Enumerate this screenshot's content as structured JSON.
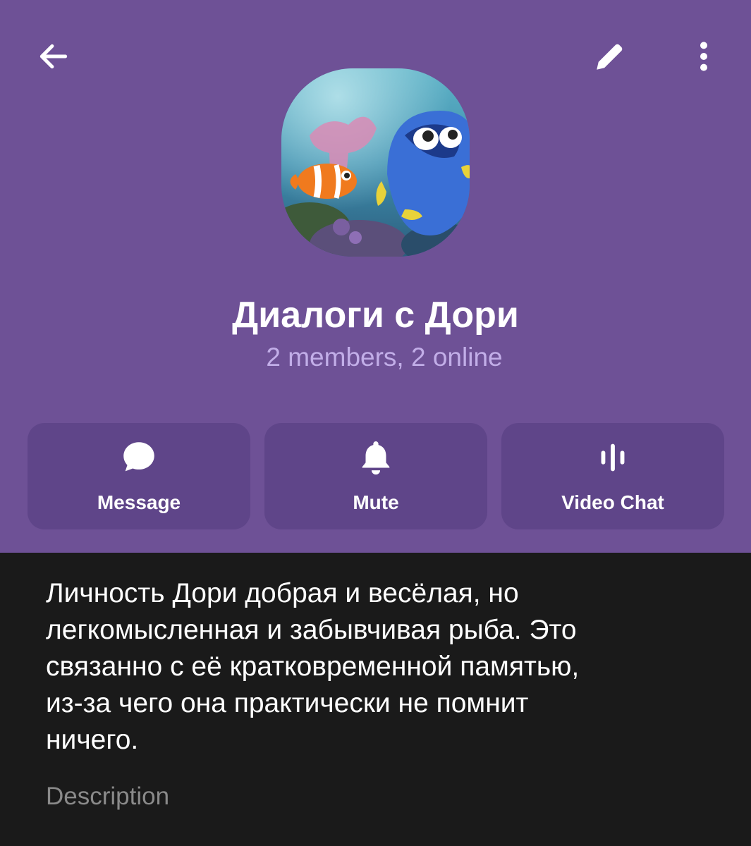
{
  "header": {
    "title": "Диалоги с Дори",
    "subtitle": "2 members, 2 online",
    "background_color": "#6e5196",
    "icons": {
      "back": "arrow-left-icon",
      "edit": "pencil-icon",
      "more": "more-vertical-icon"
    }
  },
  "avatar": {
    "description_visible": false
  },
  "actions": [
    {
      "label": "Message",
      "icon": "chat-bubble-icon"
    },
    {
      "label": "Mute",
      "icon": "bell-icon"
    },
    {
      "label": "Video Chat",
      "icon": "voice-wave-icon"
    }
  ],
  "info": {
    "description_text": "Личность Дори добрая и весёлая, но\nлегкомысленная и забывчивая рыба. Это\nсвязанно с её кратковременной памятью,\nиз-за чего она практически не помнит\nничего.",
    "description_label": "Description"
  }
}
